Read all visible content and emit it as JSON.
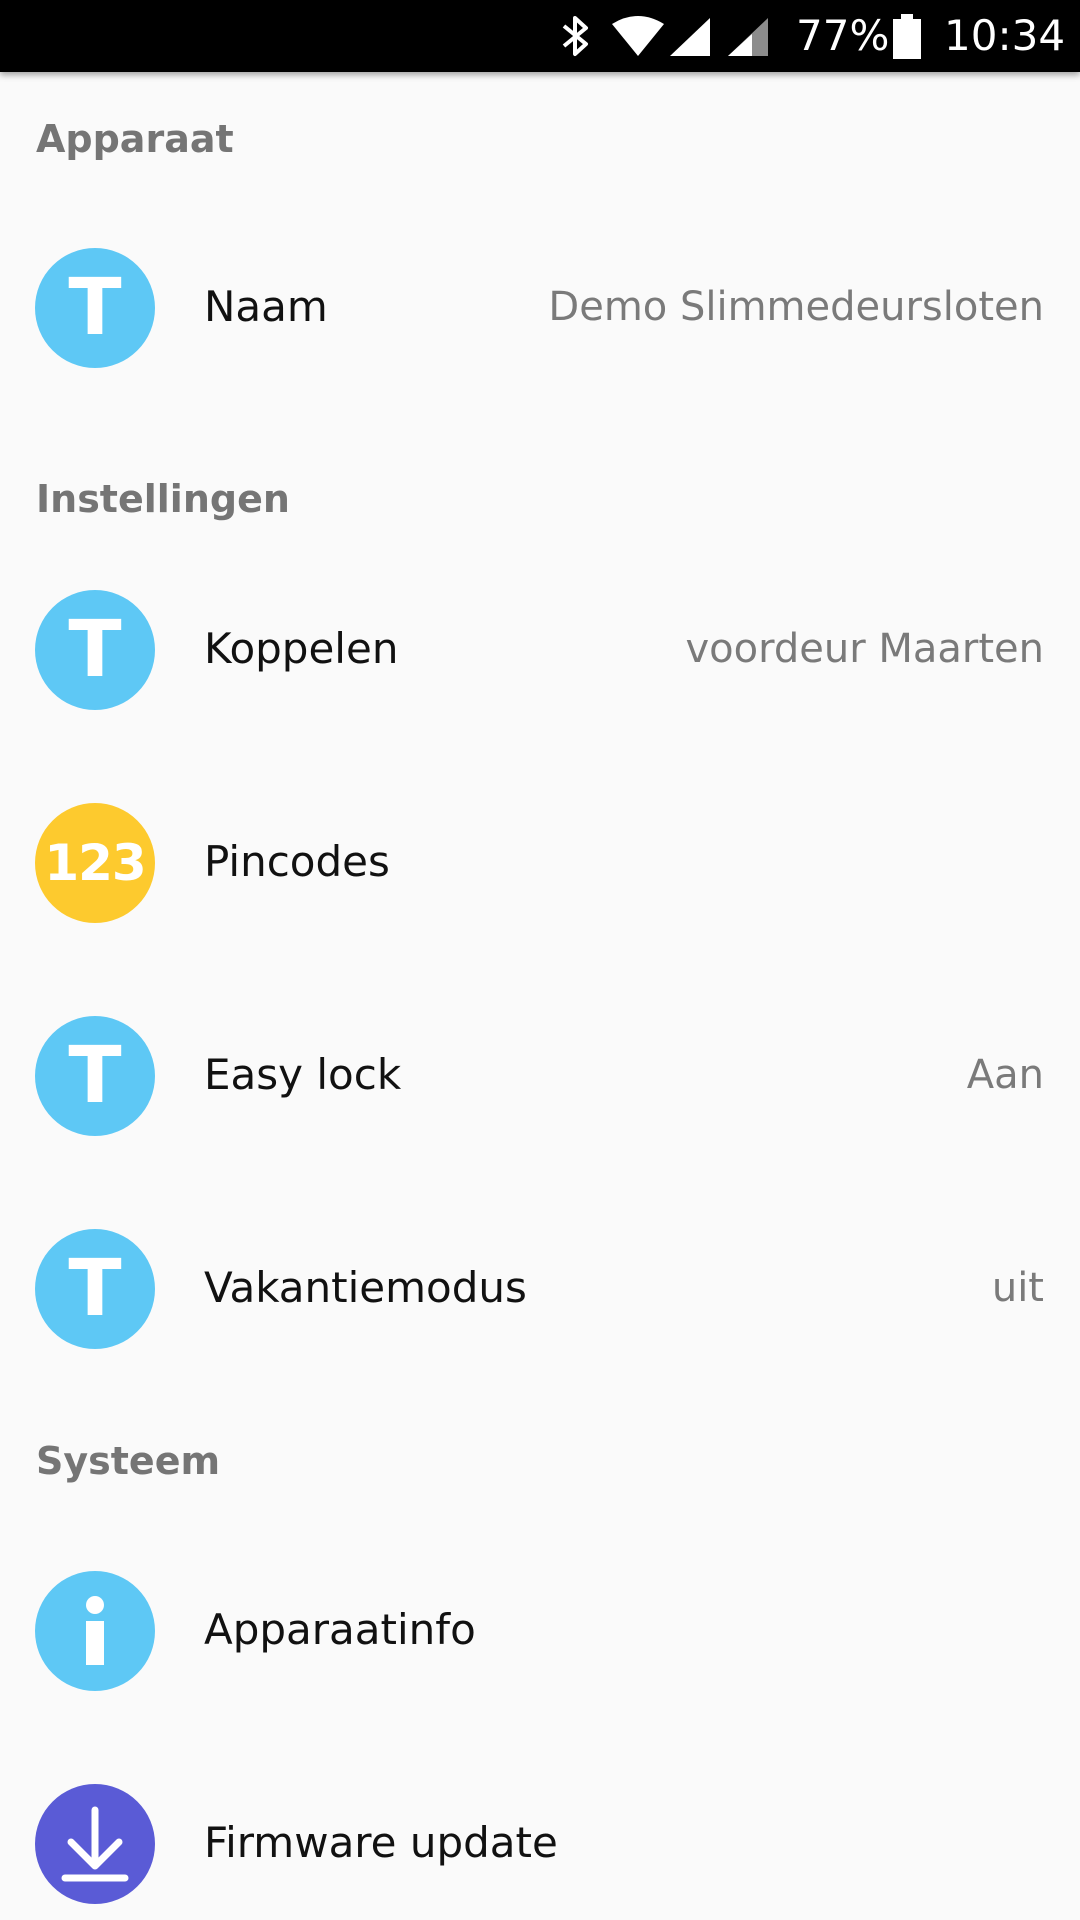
{
  "status_bar": {
    "icons": [
      "bluetooth-icon",
      "wifi-icon",
      "signal-icon",
      "signal-icon-2",
      "battery-icon"
    ],
    "battery": "77%",
    "time": "10:34"
  },
  "colors": {
    "status_bar_bg": "#000000",
    "background": "#fafafa",
    "avatar_blue": "#5ec8f5",
    "avatar_yellow": "#fdca2e",
    "avatar_indigo": "#5a5bd6",
    "section_header": "#757575",
    "value_text": "#7a7a7a"
  },
  "sections": [
    {
      "header": "Apparaat",
      "items": [
        {
          "avatar": "T",
          "icon": "letter-t-icon",
          "title": "Naam",
          "value": "Demo Slimmedeursloten"
        }
      ]
    },
    {
      "header": "Instellingen",
      "items": [
        {
          "avatar": "T",
          "icon": "letter-t-icon",
          "title": "Koppelen",
          "value": "voordeur Maarten"
        },
        {
          "avatar": "123",
          "icon": "pincode-icon",
          "title": "Pincodes",
          "value": ""
        },
        {
          "avatar": "T",
          "icon": "letter-t-icon",
          "title": "Easy lock",
          "value": "Aan"
        },
        {
          "avatar": "T",
          "icon": "letter-t-icon",
          "title": "Vakantiemodus",
          "value": "uit"
        }
      ]
    },
    {
      "header": "Systeem",
      "items": [
        {
          "avatar": "",
          "icon": "info-icon",
          "title": "Apparaatinfo",
          "value": ""
        },
        {
          "avatar": "",
          "icon": "download-icon",
          "title": "Firmware update",
          "value": ""
        }
      ]
    }
  ]
}
